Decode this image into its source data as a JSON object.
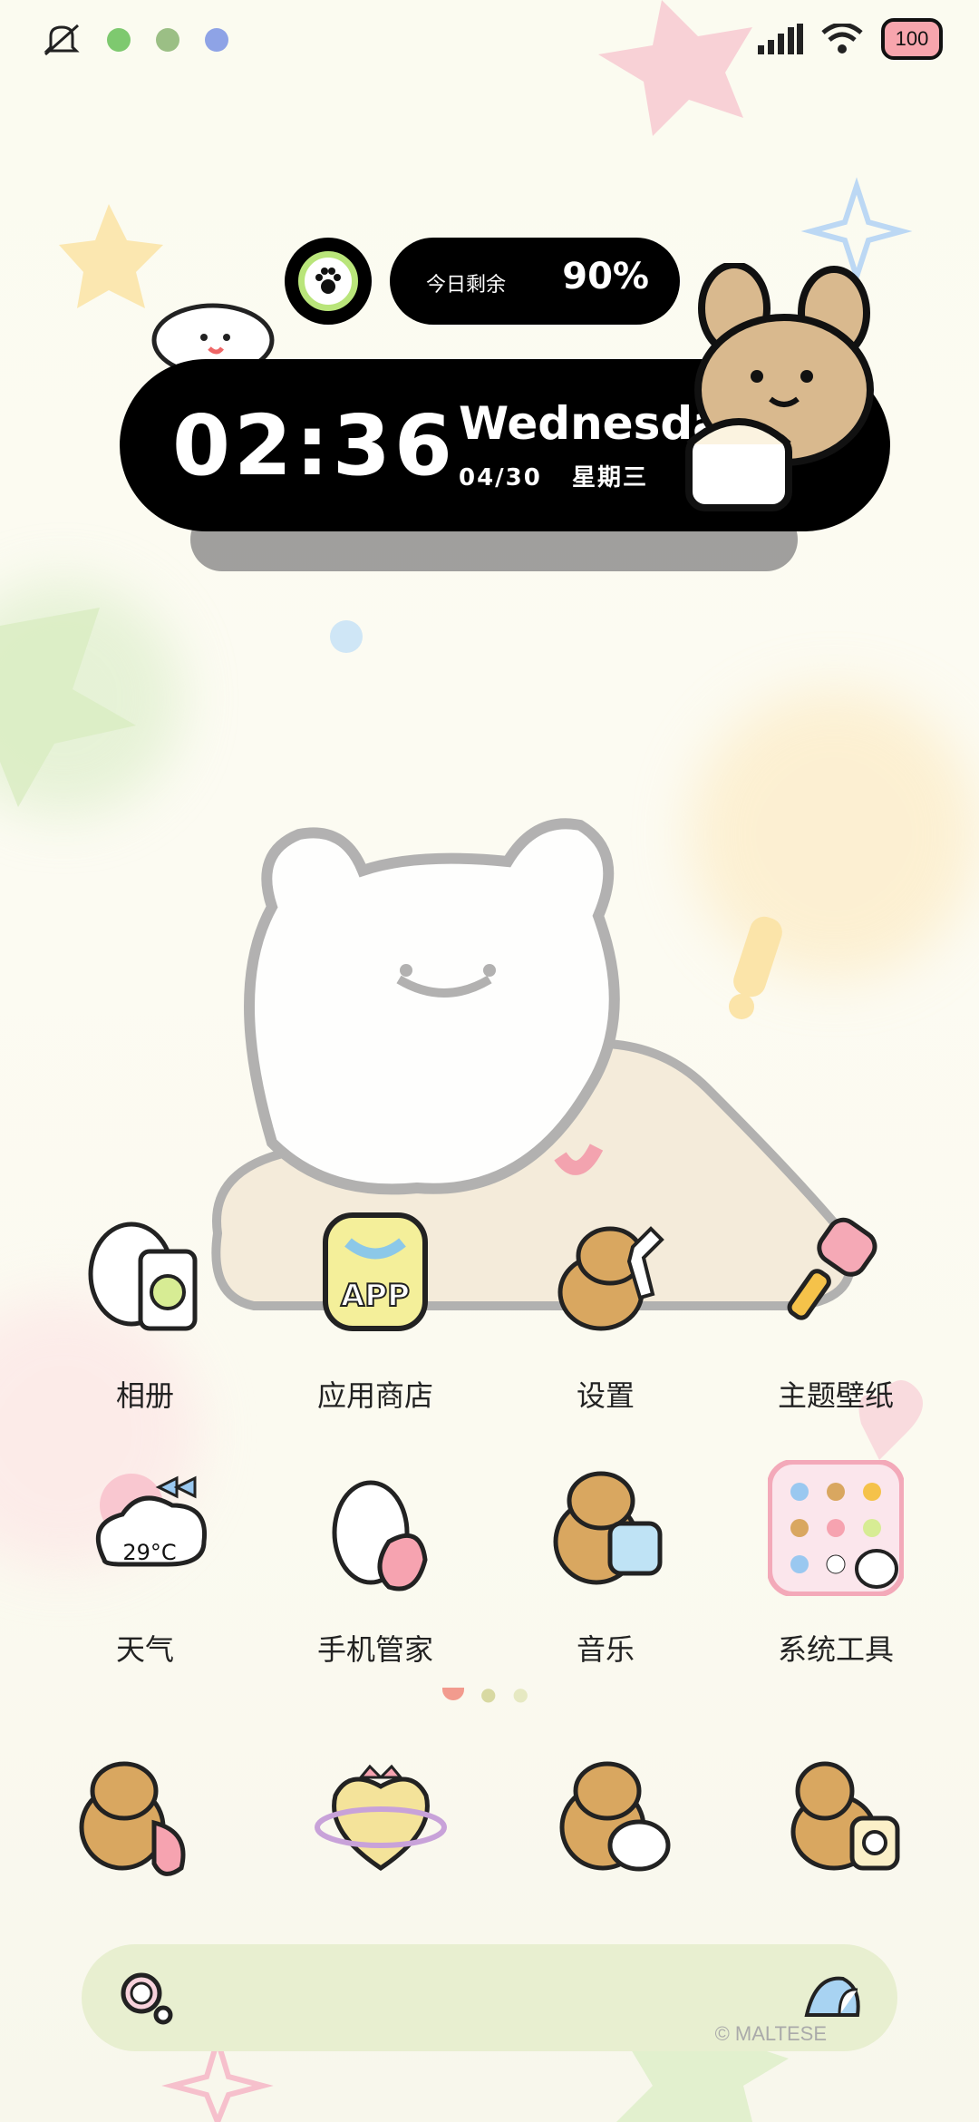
{
  "status_bar": {
    "icons": [
      "mute-icon",
      "app-notif-icon-1",
      "app-notif-icon-2",
      "app-notif-icon-3"
    ],
    "right_icons": [
      "signal-icon",
      "wifi-icon"
    ],
    "battery": "100"
  },
  "widget": {
    "remaining_label": "今日剩余",
    "remaining_value": "90%",
    "time": "02:36",
    "weekday": "Wednesday",
    "date": "04/30",
    "weekday_cn": "星期三"
  },
  "apps_row1": [
    {
      "label": "相册",
      "icon": "album-icon"
    },
    {
      "label": "应用商店",
      "icon": "app-store-icon"
    },
    {
      "label": "设置",
      "icon": "settings-icon"
    },
    {
      "label": "主题壁纸",
      "icon": "theme-wallpaper-icon"
    }
  ],
  "apps_row2": [
    {
      "label": "天气",
      "icon": "weather-icon",
      "temp": "29°C"
    },
    {
      "label": "手机管家",
      "icon": "phone-manager-icon"
    },
    {
      "label": "音乐",
      "icon": "music-icon"
    },
    {
      "label": "系统工具",
      "icon": "system-tools-folder-icon"
    }
  ],
  "app_store_badge": "APP",
  "dock": [
    "phone-icon",
    "browser-icon",
    "messages-icon",
    "camera-icon"
  ],
  "search": {
    "credit": "© MALTESE"
  },
  "colors": {
    "accent_green": "#b9e57a",
    "search_bg": "#e8efd0",
    "pink": "#f6a3b0"
  }
}
